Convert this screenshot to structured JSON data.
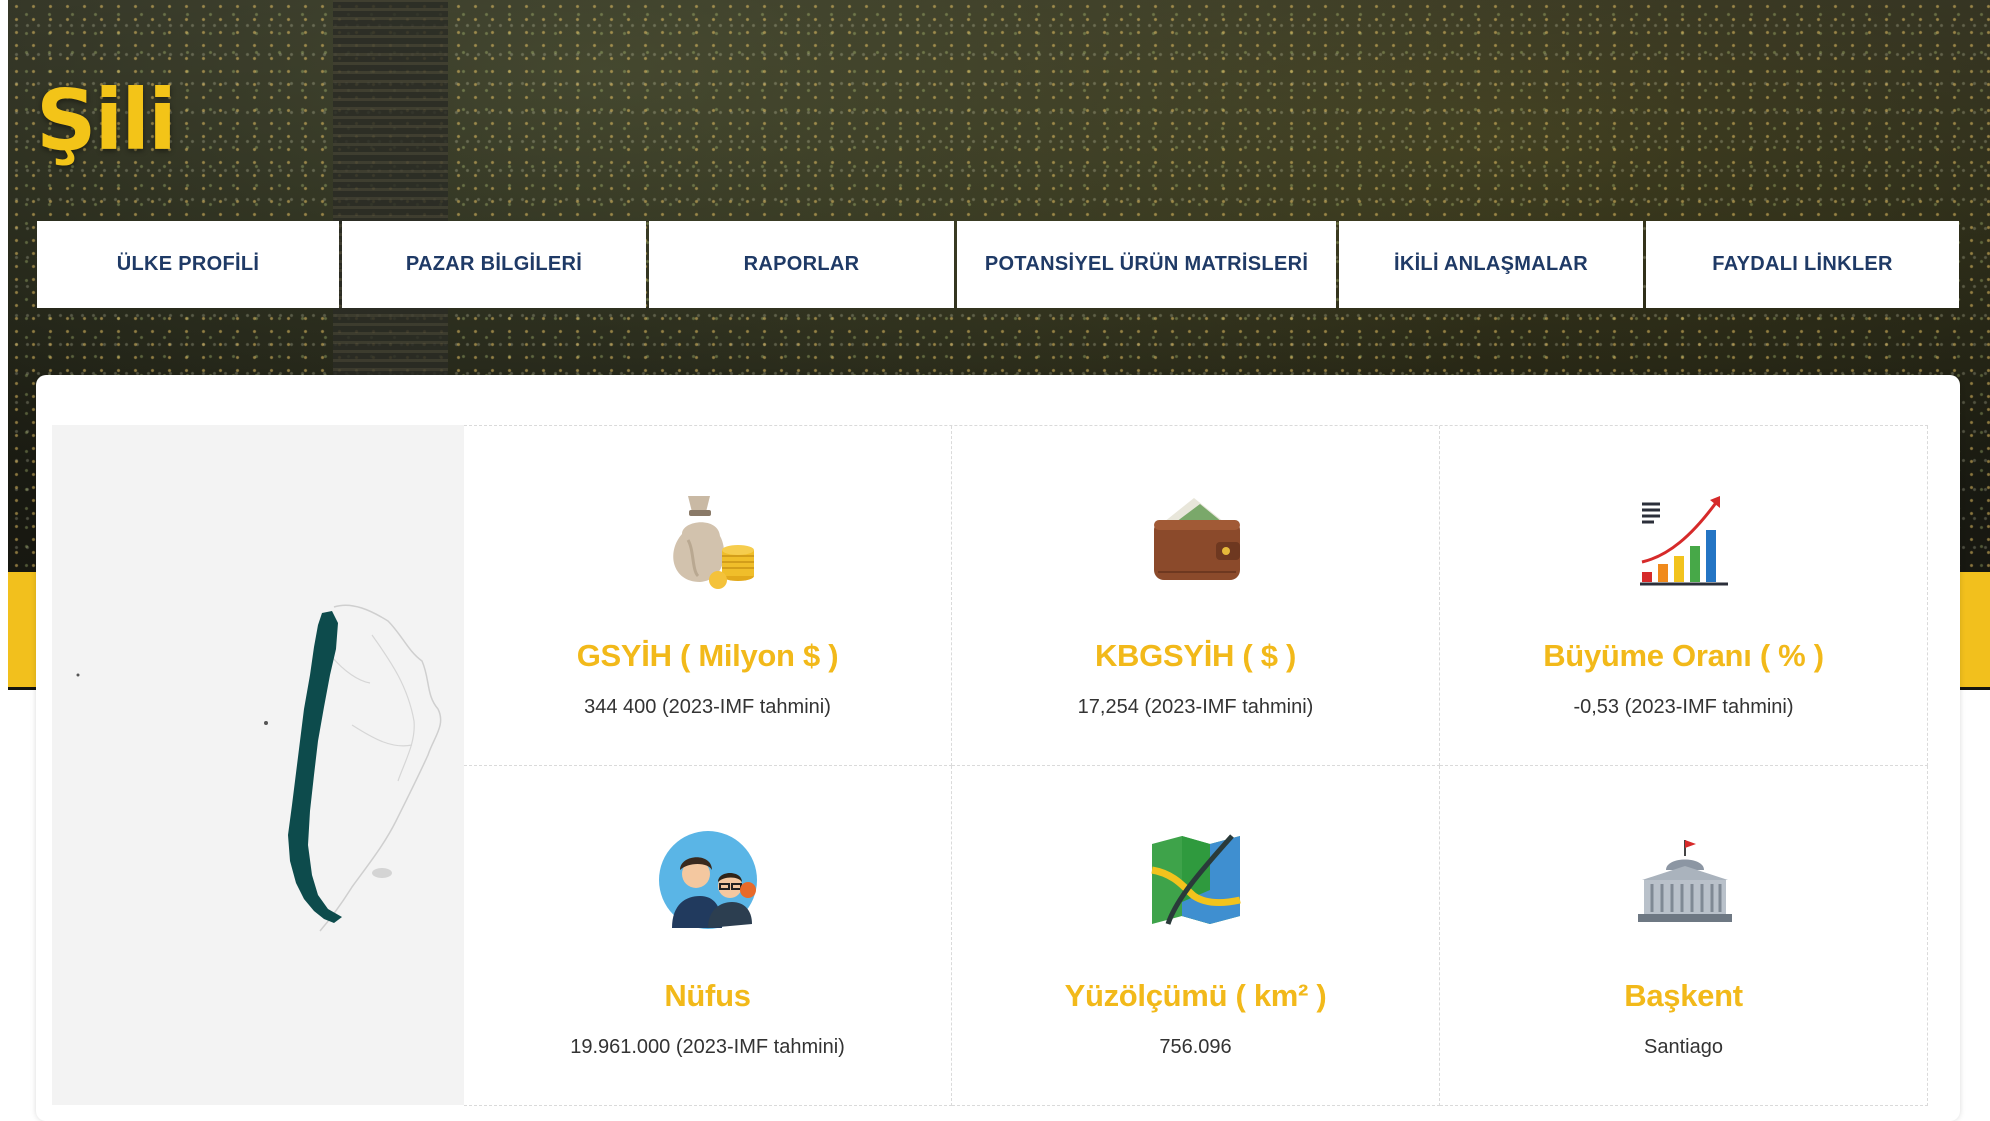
{
  "header": {
    "country_title": "Şili"
  },
  "nav": {
    "items": [
      {
        "label": "ÜLKE PROFİLİ"
      },
      {
        "label": "PAZAR BİLGİLERİ"
      },
      {
        "label": "RAPORLAR"
      },
      {
        "label": "POTANSİYEL ÜRÜN MATRİSLERİ"
      },
      {
        "label": "İKİLİ ANLAŞMALAR"
      },
      {
        "label": "FAYDALI LİNKLER"
      }
    ]
  },
  "stats": [
    {
      "label": "GSYİH ( Milyon $ )",
      "value": "344 400 (2023-IMF tahmini)",
      "icon": "money-bag-icon"
    },
    {
      "label": "KBGSYİH ( $ )",
      "value": "17,254 (2023-IMF tahmini)",
      "icon": "wallet-icon"
    },
    {
      "label": "Büyüme Oranı ( % )",
      "value": "-0,53 (2023-IMF tahmini)",
      "icon": "growth-chart-icon"
    },
    {
      "label": "Nüfus",
      "value": "19.961.000 (2023-IMF tahmini)",
      "icon": "people-icon"
    },
    {
      "label": "Yüzölçümü ( km² )",
      "value": "756.096",
      "icon": "map-icon"
    },
    {
      "label": "Başkent",
      "value": "Santiago",
      "icon": "capitol-building-icon"
    }
  ],
  "colors": {
    "accent_yellow": "#f2b91a",
    "nav_text": "#1f3a66",
    "map_fill": "#0d4b4c"
  }
}
